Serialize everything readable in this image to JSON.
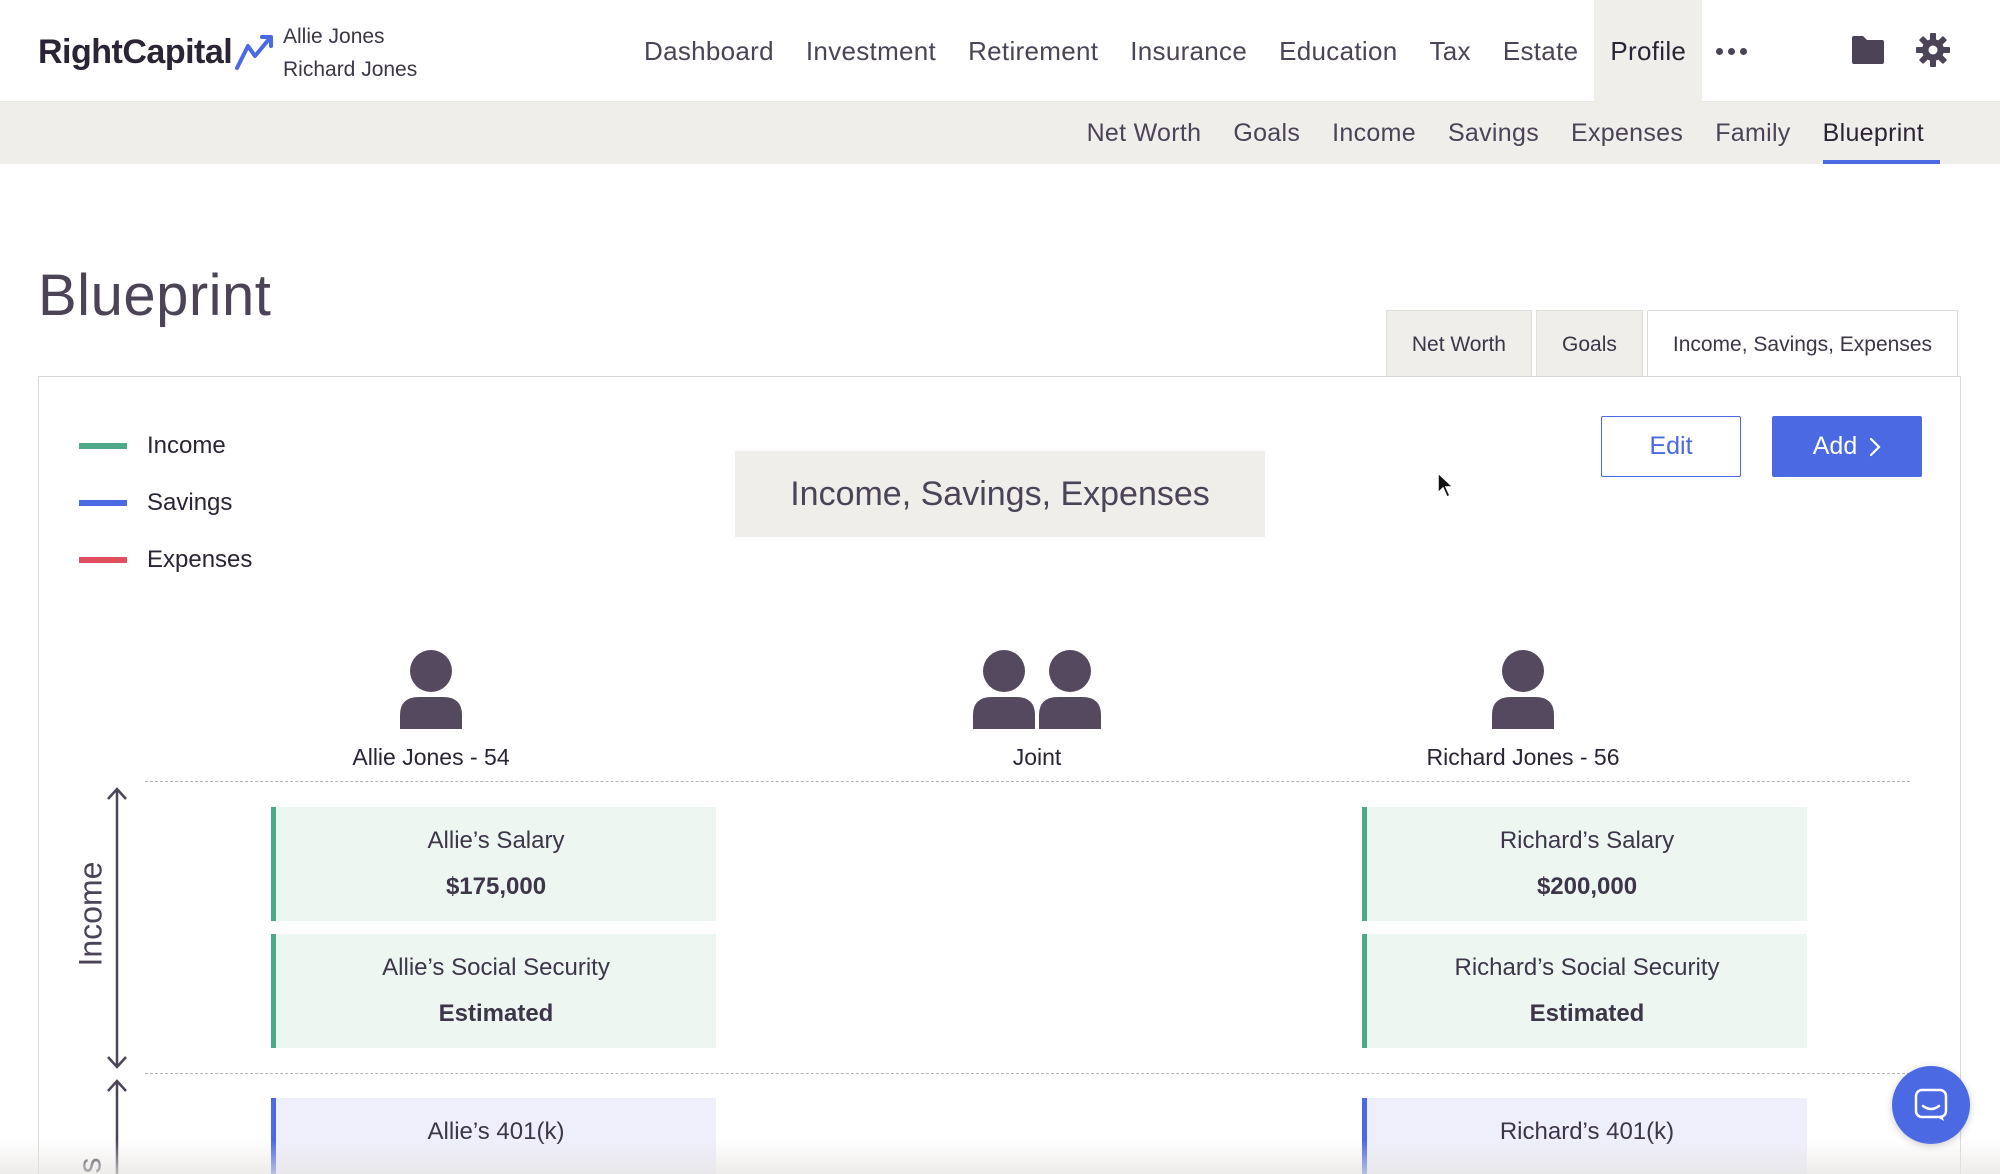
{
  "header": {
    "logo_text": "RightCapital",
    "clients": [
      "Allie Jones",
      "Richard Jones"
    ],
    "nav": [
      {
        "label": "Dashboard",
        "active": false
      },
      {
        "label": "Investment",
        "active": false
      },
      {
        "label": "Retirement",
        "active": false
      },
      {
        "label": "Insurance",
        "active": false
      },
      {
        "label": "Education",
        "active": false
      },
      {
        "label": "Tax",
        "active": false
      },
      {
        "label": "Estate",
        "active": false
      },
      {
        "label": "Profile",
        "active": true
      }
    ],
    "icons": [
      "more-icon",
      "folder-icon",
      "gear-icon"
    ]
  },
  "subnav": {
    "items": [
      {
        "label": "Net Worth",
        "active": false
      },
      {
        "label": "Goals",
        "active": false
      },
      {
        "label": "Income",
        "active": false
      },
      {
        "label": "Savings",
        "active": false
      },
      {
        "label": "Expenses",
        "active": false
      },
      {
        "label": "Family",
        "active": false
      },
      {
        "label": "Blueprint",
        "active": true
      }
    ]
  },
  "page": {
    "title": "Blueprint",
    "view_tabs": [
      {
        "label": "Net Worth",
        "active": false
      },
      {
        "label": "Goals",
        "active": false
      },
      {
        "label": "Income, Savings, Expenses",
        "active": true
      }
    ]
  },
  "panel": {
    "legend": [
      {
        "label": "Income",
        "color": "#4fa888"
      },
      {
        "label": "Savings",
        "color": "#4a69e2"
      },
      {
        "label": "Expenses",
        "color": "#e0505f"
      }
    ],
    "heading": "Income, Savings, Expenses",
    "edit_label": "Edit",
    "add_label": "Add",
    "people": [
      {
        "name": "Allie Jones - 54",
        "icon": "person-icon"
      },
      {
        "name": "Joint",
        "icon": "couple-icon"
      },
      {
        "name": "Richard Jones - 56",
        "icon": "person-icon"
      }
    ],
    "sections": {
      "income_label": "Income",
      "savings_label_partial": "s"
    },
    "income_cards": [
      {
        "title": "Allie’s Salary",
        "value": "$175,000"
      },
      {
        "title": "Allie’s Social Security",
        "value": "Estimated"
      },
      {
        "title": "Richard’s Salary",
        "value": "$200,000"
      },
      {
        "title": "Richard’s Social Security",
        "value": "Estimated"
      }
    ],
    "savings_cards": [
      {
        "title": "Allie’s 401(k)"
      },
      {
        "title": "Richard’s 401(k)"
      }
    ]
  }
}
